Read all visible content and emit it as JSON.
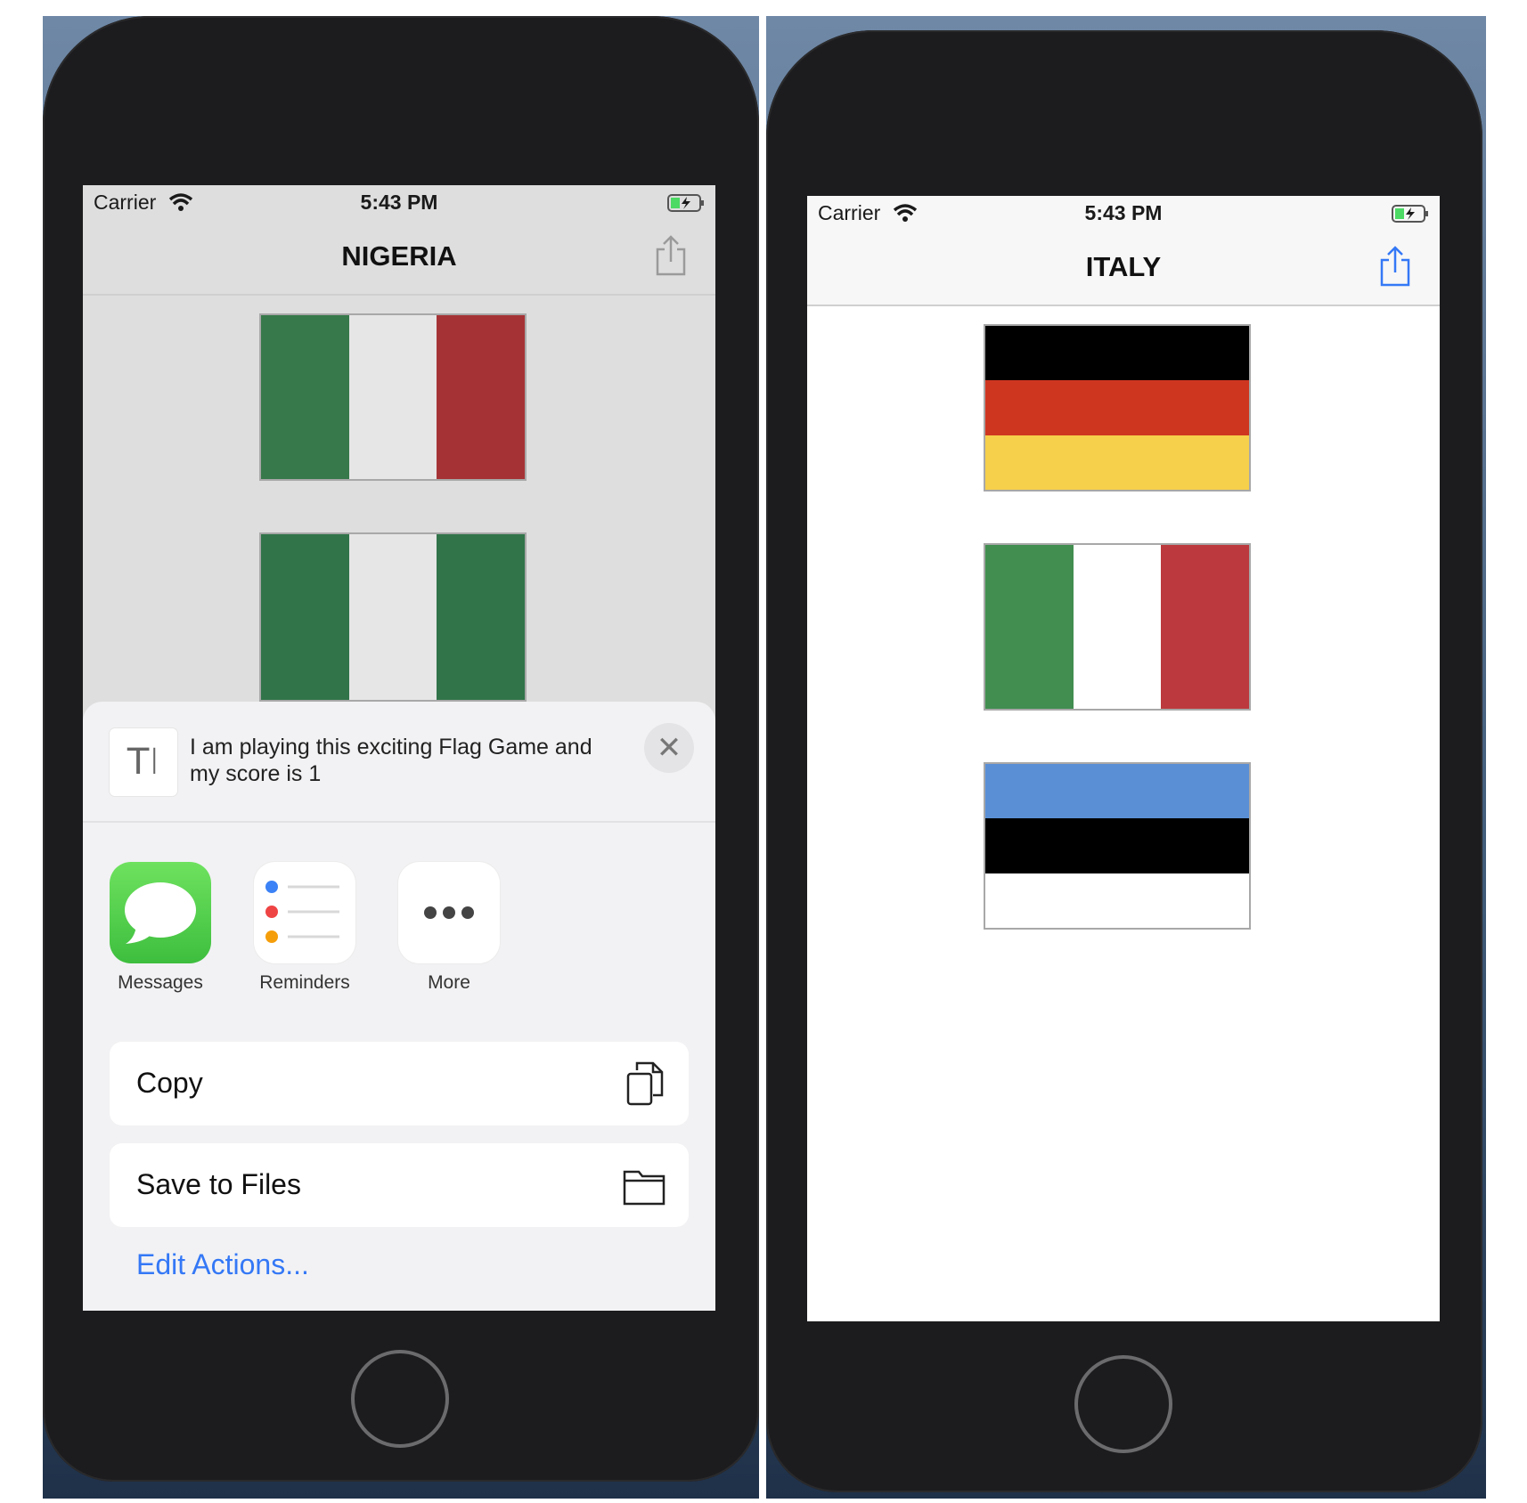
{
  "left_phone": {
    "status": {
      "carrier": "Carrier",
      "time": "5:43 PM"
    },
    "title": "NIGERIA",
    "share_icon": "share-icon",
    "flags": [
      {
        "country": "Italy",
        "orientation": "vertical",
        "colors": [
          "#37794a",
          "#e6e6e6",
          "#a53336"
        ]
      },
      {
        "country": "Nigeria",
        "orientation": "vertical",
        "colors": [
          "#31744a",
          "#e6e6e6",
          "#31744a"
        ]
      }
    ],
    "share_sheet": {
      "text_icon": "text-format-icon",
      "message": "I am playing this exciting Flag Game and my score is 1",
      "close_icon": "close-icon",
      "apps": [
        {
          "label": "Messages",
          "icon": "messages-icon"
        },
        {
          "label": "Reminders",
          "icon": "reminders-icon"
        },
        {
          "label": "More",
          "icon": "more-icon"
        }
      ],
      "actions": [
        {
          "label": "Copy",
          "icon": "copy-icon"
        },
        {
          "label": "Save to Files",
          "icon": "folder-icon"
        }
      ],
      "edit_actions": "Edit Actions..."
    }
  },
  "right_phone": {
    "status": {
      "carrier": "Carrier",
      "time": "5:43 PM"
    },
    "title": "ITALY",
    "share_icon": "share-icon",
    "accent": "#3478f6",
    "flags": [
      {
        "country": "Germany",
        "orientation": "horizontal",
        "colors": [
          "#000000",
          "#cf3620",
          "#f6cf4b"
        ]
      },
      {
        "country": "Italy",
        "orientation": "vertical",
        "colors": [
          "#418e50",
          "#ffffff",
          "#bc3a3d"
        ]
      },
      {
        "country": "Estonia",
        "orientation": "horizontal",
        "colors": [
          "#5a8fd6",
          "#000000",
          "#ffffff"
        ]
      }
    ]
  }
}
